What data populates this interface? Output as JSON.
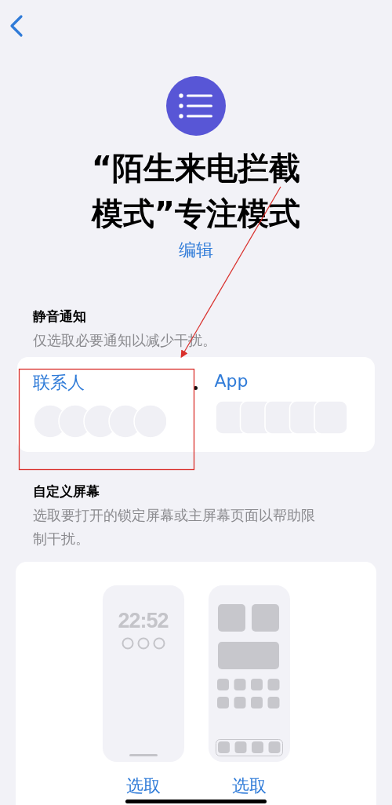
{
  "header": {
    "title_lines": [
      "“陌生来电拦截",
      "模式”专注模式"
    ],
    "edit_link": "编辑"
  },
  "silence_notifications": {
    "heading": "静音通知",
    "description": "仅选取必要通知以减少干扰。",
    "options": [
      {
        "kind": "contacts",
        "label": "联系人"
      },
      {
        "kind": "apps",
        "label": "App"
      }
    ]
  },
  "customize_screens": {
    "heading": "自定义屏幕",
    "description": "选取要打开的锁定屏幕或主屏幕页面以帮助限制干扰。",
    "screens": [
      {
        "kind": "lock",
        "time": "22:52",
        "button": "选取"
      },
      {
        "kind": "home",
        "button": "选取"
      }
    ]
  },
  "annotation": {
    "highlight_box": true,
    "arrow": true
  }
}
